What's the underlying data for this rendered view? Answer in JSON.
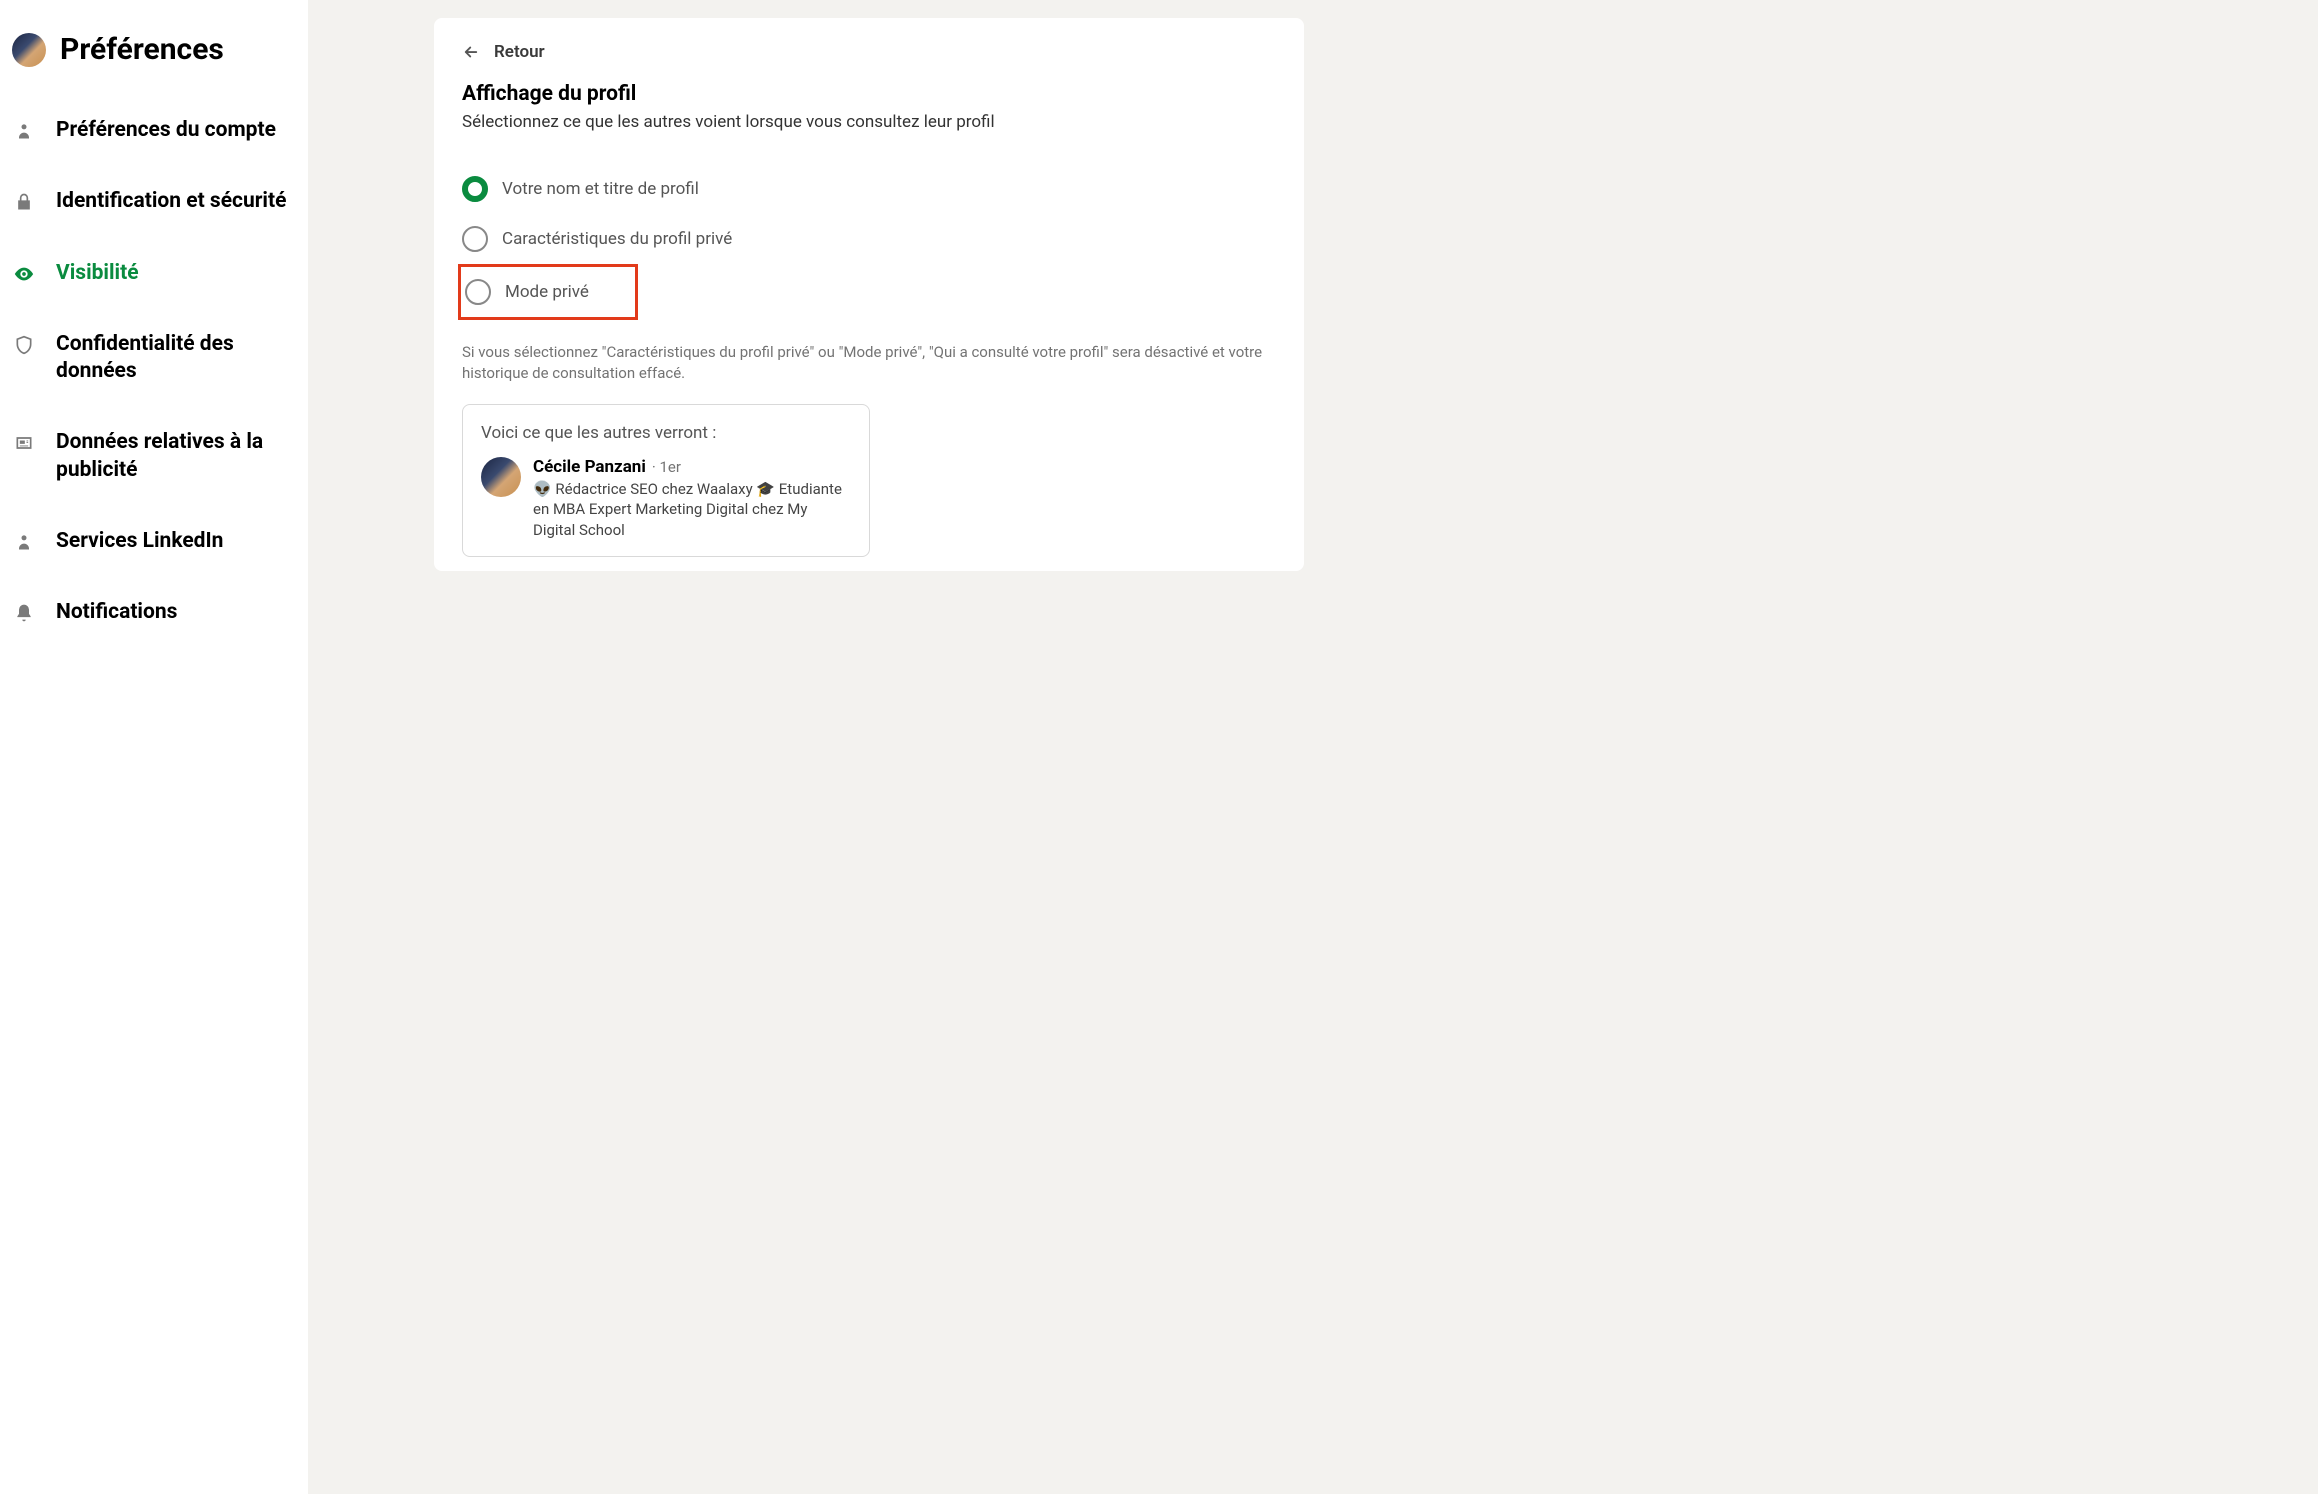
{
  "sidebar": {
    "title": "Préférences",
    "items": [
      {
        "label": "Préférences du compte",
        "active": false
      },
      {
        "label": "Identification et sécurité",
        "active": false
      },
      {
        "label": "Visibilité",
        "active": true
      },
      {
        "label": "Confidentialité des données",
        "active": false
      },
      {
        "label": "Données relatives à la publicité",
        "active": false
      },
      {
        "label": "Services LinkedIn",
        "active": false
      },
      {
        "label": "Notifications",
        "active": false
      }
    ]
  },
  "main": {
    "back_label": "Retour",
    "section_title": "Affichage du profil",
    "section_subtitle": "Sélectionnez ce que les autres voient lorsque vous consultez leur profil",
    "radio_options": [
      {
        "label": "Votre nom et titre de profil",
        "selected": true,
        "highlighted": false
      },
      {
        "label": "Caractéristiques du profil privé",
        "selected": false,
        "highlighted": false
      },
      {
        "label": "Mode privé",
        "selected": false,
        "highlighted": true
      }
    ],
    "info_text": "Si vous sélectionnez \"Caractéristiques du profil privé\" ou \"Mode privé\", \"Qui a consulté votre profil\" sera désactivé et votre historique de consultation effacé.",
    "preview": {
      "title": "Voici ce que les autres verront :",
      "name": "Cécile Panzani",
      "degree": "· 1er",
      "headline": "👽 Rédactrice SEO chez Waalaxy 🎓 Etudiante en MBA Expert Marketing Digital chez My Digital School"
    }
  }
}
